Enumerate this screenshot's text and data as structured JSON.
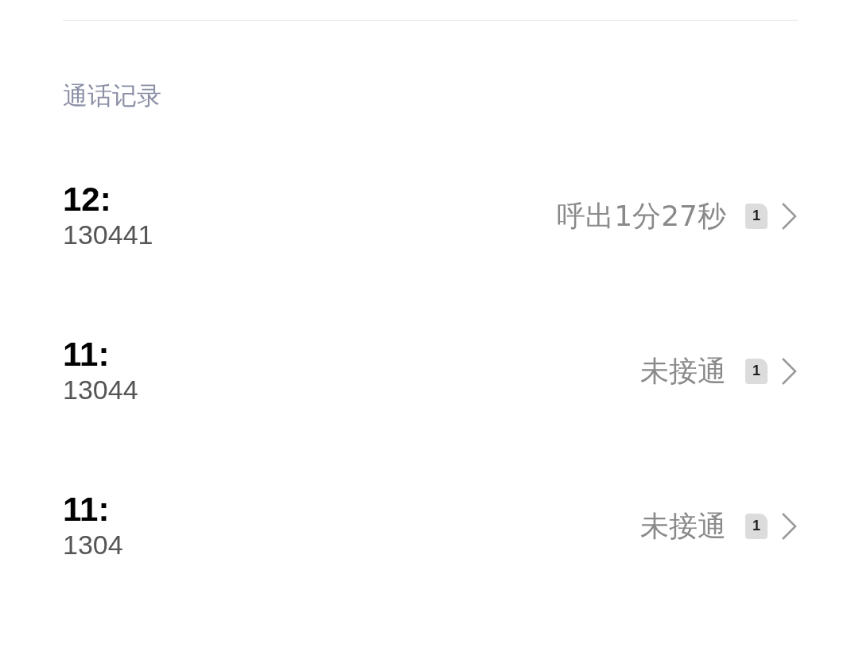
{
  "section_title": "通话记录",
  "calls": [
    {
      "time": "12:",
      "number": "130441",
      "status": "呼出1分27秒",
      "sim": "1"
    },
    {
      "time": "11:",
      "number": "13044",
      "status": "未接通",
      "sim": "1"
    },
    {
      "time": "11:",
      "number": "1304",
      "status": "未接通",
      "sim": "1"
    }
  ]
}
